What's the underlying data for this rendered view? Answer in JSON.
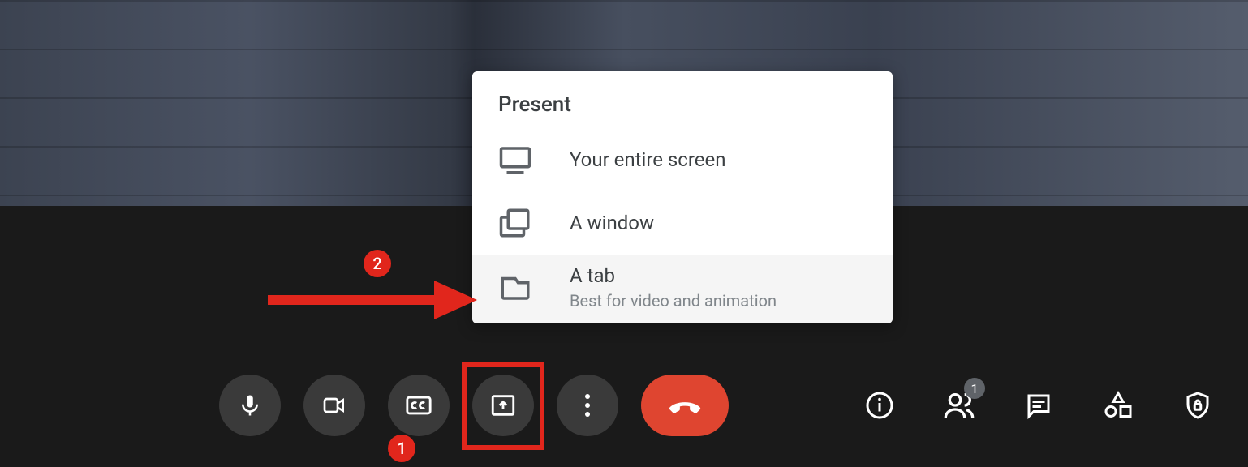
{
  "present_menu": {
    "title": "Present",
    "options": [
      {
        "label": "Your entire screen",
        "sub": "",
        "icon": "monitor-icon",
        "hovered": false
      },
      {
        "label": "A window",
        "sub": "",
        "icon": "window-icon",
        "hovered": false
      },
      {
        "label": "A tab",
        "sub": "Best for video and animation",
        "icon": "tab-icon",
        "hovered": true
      }
    ]
  },
  "toolbar": {
    "center": [
      {
        "name": "microphone-button",
        "icon": "mic-icon"
      },
      {
        "name": "camera-button",
        "icon": "video-icon"
      },
      {
        "name": "captions-button",
        "icon": "cc-icon"
      },
      {
        "name": "present-button",
        "icon": "present-screen-icon",
        "highlighted": true
      },
      {
        "name": "more-options-button",
        "icon": "more-vert-icon"
      },
      {
        "name": "end-call-button",
        "icon": "phone-hangup-icon",
        "style": "end"
      }
    ],
    "right": [
      {
        "name": "meeting-details-button",
        "icon": "info-icon"
      },
      {
        "name": "people-button",
        "icon": "people-icon",
        "badge": "1"
      },
      {
        "name": "chat-button",
        "icon": "chat-icon"
      },
      {
        "name": "activities-button",
        "icon": "activities-icon"
      },
      {
        "name": "security-button",
        "icon": "shield-lock-icon"
      }
    ]
  },
  "annotations": {
    "badge1": "1",
    "badge2": "2",
    "arrow_color": "#E1261C"
  }
}
